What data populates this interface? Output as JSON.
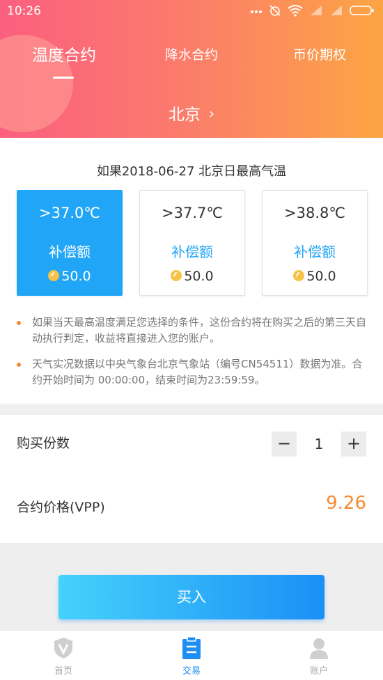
{
  "status_bar": {
    "time": "10:26",
    "battery": "battery-icon",
    "wifi": "wifi-icon"
  },
  "tabs": [
    {
      "label": "温度合约",
      "active": true
    },
    {
      "label": "降水合约",
      "active": false
    },
    {
      "label": "币价期权",
      "active": false
    }
  ],
  "city": {
    "name": "北京"
  },
  "question": "如果2018-06-27 北京日最高气温",
  "options": [
    {
      "temp": ">37.0℃",
      "label": "补偿额",
      "amount": "50.0",
      "selected": true
    },
    {
      "temp": ">37.7℃",
      "label": "补偿额",
      "amount": "50.0",
      "selected": false
    },
    {
      "temp": ">38.8℃",
      "label": "补偿额",
      "amount": "50.0",
      "selected": false
    }
  ],
  "notes": [
    "如果当天最高温度满足您选择的条件，这份合约将在购买之后的第三天自动执行判定，收益将直接进入您的账户。",
    "天气实况数据以中央气象台北京气象站（编号CN54511）数据为准。合约开始时间为 00:00:00，结束时间为23:59:59。"
  ],
  "order": {
    "qty_label": "购买份数",
    "qty": "1",
    "minus": "−",
    "plus": "+",
    "price_label": "合约价格(VPP)",
    "price": "9.26"
  },
  "buy_button": "买入",
  "bottom_nav": [
    {
      "label": "首页",
      "icon": "shield-v-icon",
      "active": false
    },
    {
      "label": "交易",
      "icon": "clipboard-icon",
      "active": true
    },
    {
      "label": "账户",
      "icon": "user-icon",
      "active": false
    }
  ],
  "colors": {
    "accent_blue": "#21a5f7",
    "price_orange": "#f68a33",
    "header_start": "#fb5f7f",
    "header_end": "#fca544"
  }
}
